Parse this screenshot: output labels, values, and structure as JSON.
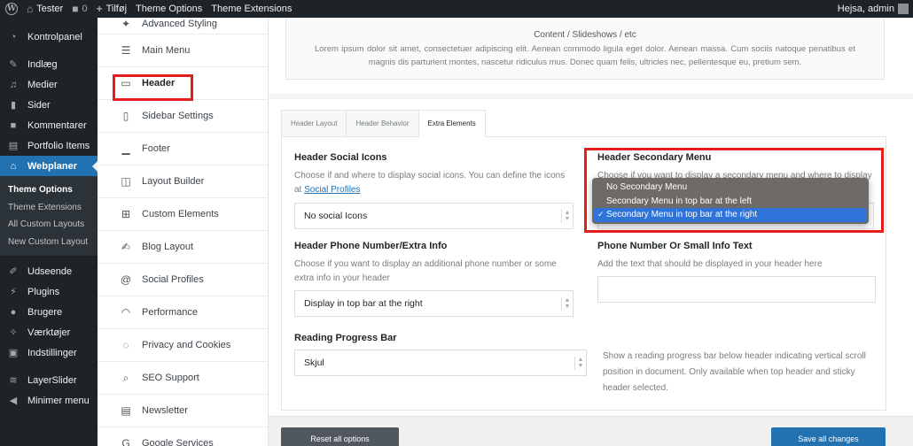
{
  "adminbar": {
    "site_name": "Tester",
    "comments_count": "0",
    "new_label": "Tilføj",
    "theme_options": "Theme Options",
    "theme_extensions": "Theme Extensions",
    "greeting": "Hejsa, admin"
  },
  "adminmenu": {
    "items_top": [
      {
        "label": "Kontrolpanel",
        "icon": "dashboard-icon"
      },
      {
        "label": "Indlæg",
        "icon": "pin-icon"
      },
      {
        "label": "Medier",
        "icon": "media-icon"
      },
      {
        "label": "Sider",
        "icon": "page-icon"
      },
      {
        "label": "Kommentarer",
        "icon": "comment-icon"
      },
      {
        "label": "Portfolio Items",
        "icon": "portfolio-icon"
      },
      {
        "label": "Webplaner",
        "icon": "home-icon"
      }
    ],
    "submenu": [
      "Theme Options",
      "Theme Extensions",
      "All Custom Layouts",
      "New Custom Layout"
    ],
    "items_bottom": [
      {
        "label": "Udseende",
        "icon": "brush-icon"
      },
      {
        "label": "Plugins",
        "icon": "plug-icon"
      },
      {
        "label": "Brugere",
        "icon": "user-icon"
      },
      {
        "label": "Værktøjer",
        "icon": "wrench-icon"
      },
      {
        "label": "Indstillinger",
        "icon": "settings-icon"
      },
      {
        "label": "LayerSlider",
        "icon": "layers-icon"
      },
      {
        "label": "Minimer menu",
        "icon": "collapse-icon"
      }
    ]
  },
  "optnav": {
    "items": [
      {
        "label": "Advanced Styling",
        "icon": "wand-icon"
      },
      {
        "label": "Main Menu",
        "icon": "list-icon"
      },
      {
        "label": "Header",
        "icon": "header-icon"
      },
      {
        "label": "Sidebar Settings",
        "icon": "sidebar-icon"
      },
      {
        "label": "Footer",
        "icon": "footer-icon"
      },
      {
        "label": "Layout Builder",
        "icon": "builder-icon"
      },
      {
        "label": "Custom Elements",
        "icon": "elements-icon"
      },
      {
        "label": "Blog Layout",
        "icon": "edit-icon"
      },
      {
        "label": "Social Profiles",
        "icon": "at-icon"
      },
      {
        "label": "Performance",
        "icon": "gauge-icon"
      },
      {
        "label": "Privacy and Cookies",
        "icon": "cookie-icon"
      },
      {
        "label": "SEO Support",
        "icon": "search-icon"
      },
      {
        "label": "Newsletter",
        "icon": "newsletter-icon"
      },
      {
        "label": "Google Services",
        "icon": "google-icon"
      }
    ]
  },
  "content": {
    "top_box_title": "Content / Slideshows / etc",
    "top_box_text": "Lorem ipsum dolor sit amet, consectetuer adipiscing elit. Aenean commodo ligula eget dolor. Aenean massa. Cum sociis natoque penatibus et magnis dis parturient montes, nascetur ridiculus mus. Donec quam felis, ultricies nec, pellentesque eu, pretium sem.",
    "tabs": [
      "Header Layout",
      "Header Behavior",
      "Extra Elements"
    ],
    "social": {
      "title": "Header Social Icons",
      "desc": "Choose if and where to display social icons. You can define the icons at",
      "link": "Social Profiles",
      "value": "No social Icons"
    },
    "secondary": {
      "title": "Header Secondary Menu",
      "desc": "Choose if you want to display a secondary menu and where to display",
      "options": [
        "No Secondary Menu",
        "Secondary Menu in top bar at the left",
        "Secondary Menu in top bar at the right"
      ],
      "selected_index": 2
    },
    "phone": {
      "title": "Header Phone Number/Extra Info",
      "desc": "Choose if you want to display an additional phone number or some extra info in your header",
      "value": "Display in top bar at the right"
    },
    "phone_text": {
      "title": "Phone Number Or Small Info Text",
      "desc": "Add the text that should be displayed in your header here",
      "value": ""
    },
    "progress": {
      "title": "Reading Progress Bar",
      "value": "Skjul",
      "desc": "Show a reading progress bar below header indicating vertical scroll position in document. Only available when top header and sticky header selected."
    },
    "reset_label": "Reset all options",
    "save_label": "Save all changes"
  },
  "colors": {
    "admin_dark": "#1d2327",
    "accent_blue": "#2271b1",
    "highlight_red": "#e51d1d"
  }
}
